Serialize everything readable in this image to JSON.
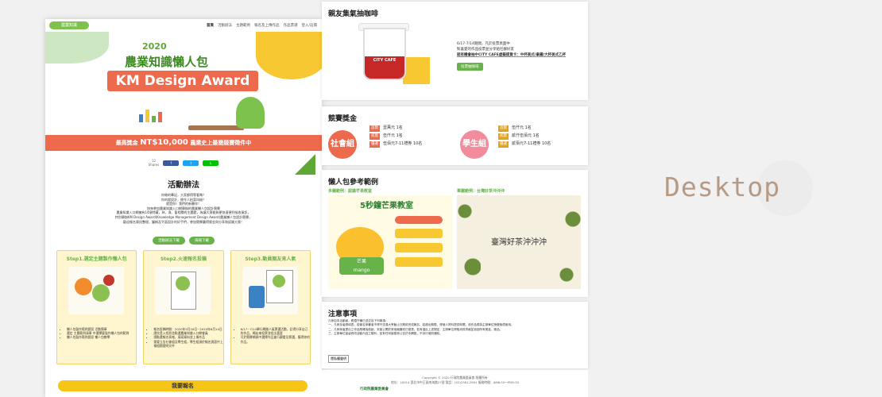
{
  "nav": {
    "logo": "農業知識",
    "items": [
      "首頁",
      "活動辦法",
      "主題範例",
      "報名及上傳作品",
      "作品票選",
      "登入/註冊"
    ]
  },
  "hero": {
    "year": "2020",
    "title": "農業知識懶人包",
    "award": "KM Design Award"
  },
  "prize": {
    "text": "最高獎金",
    "amount": "NT$10,000",
    "suffix": "農業史上最簡競賽徵件中"
  },
  "share": {
    "count": "12",
    "count_label": "Shares",
    "fb": "f",
    "tw": "t",
    "line": "L"
  },
  "activity": {
    "title": "活動辦法",
    "lines": [
      "你做的筆記，大家都得等看嗎？",
      "你的超設計，總令人拍案叫絕？",
      "就是你！我們的新夥伴！",
      "快來參加農業知識入口網舉辦的農業懶人包設計競賽",
      "農業知識入口網擁有14項特藏，林，漁、畜相關的主題館，為讓大眾能夠更快速便利吸收資訊，",
      "特別舉辦KM Design Award(Knowledge Management Design Award)農業懶人包設計競賽，",
      "歡迎報名資訊整理，圖納及平面設計的好手們，參加競賽贏得獎金與分享和認識大獎！"
    ],
    "btn1": "活動辦法下載",
    "btn2": "海報下載"
  },
  "steps": [
    {
      "title": "Step1.選定主題製作懶人包",
      "items": [
        "懶人包製作範例請見 活動簡章",
        "選定 主題範例清單 中選擇要製作懶人包的範例",
        "懶人包製作範例請見 懶人包教學"
      ]
    },
    {
      "title": "Step2.火速報名投稿",
      "items": [
        "報名投稿時間：2020年5月18日~2020年6月14日",
        "請先登入找到並點選農業知識入口網會員",
        "請點選報名表格，填寫資料並上傳作品",
        "需要立告社會組及學生組，學生組須於報名頁面中上傳相關證明文件"
      ]
    },
    {
      "title": "Step3.動員親友來人氣",
      "items": [
        "6/17~7/14舉行網路人氣票選活動，記得分享自己的作品，轉友來投票並投出喜愛",
        "可於競賽網頁中選擇作品進行觀看及票選，獲得你的作品。"
      ]
    }
  ],
  "signup": "我要報名",
  "coffee": {
    "title": "親友集氣抽咖啡",
    "lines": [
      "6/17-7/14期間，凡於投票頁面中",
      "對喜愛的作品投票並分享給社群好友",
      "就有機會抽中CITY CAFE虛擬提貨卡：中杯美式/拿鐵/大杯美式乙杯"
    ],
    "btn": "投票抽咖啡",
    "cup_label": "CITY CAFE"
  },
  "prizes": {
    "title": "競賽獎金",
    "social": "社會組",
    "student": "學生組",
    "social_list": [
      {
        "tag": "首獎",
        "text": "壹萬元 1名"
      },
      {
        "tag": "貳獎",
        "text": "伍仟元 1名"
      },
      {
        "tag": "優選",
        "text": "伍佰元7-11禮券 10名"
      }
    ],
    "student_list": [
      {
        "tag": "首獎",
        "text": "伍仟元 1名"
      },
      {
        "tag": "貳獎",
        "text": "貳仟伍佰元 1名"
      },
      {
        "tag": "優選",
        "text": "貳佰元7-11禮券 10名"
      }
    ]
  },
  "examples": {
    "title": "懶人包參考範例",
    "ex1": "多圖範例：認識芒果教室",
    "ex2": "單圖範例：台灣好茶沖沖沖",
    "ex1_title": "5秒鐘芒果教室",
    "ex1_word": "芒果",
    "ex1_en": "mango",
    "ex2_title": "臺灣好茶沖沖沖"
  },
  "notes": {
    "title": "注意事項",
    "intro": "凡參加本活動者，應遵守懶已送交及下列事項：",
    "items": [
      "一、凡參加者請填表，若報名參賽者不得不送達大會截止日期前完成報名、若超出期限、得個人資料提供時間，該作品視為主辦單位授權無償使用。",
      "二、凡參與者提出之作品應確為原創、未曾公開於其他競賽或已發表，若有違反上述規定，主辦單位得取消其資格並追回所有獎金、獎品。",
      "三、主辦單位保留修改活動內容之權利，如有任何變更將公告於本網頁，不另行個別通知。"
    ],
    "btn": "隱私權聲明"
  },
  "footer": {
    "copy": "Copyright © 2020 行政院農業委員會 版權所有",
    "addr": "地址：10014 臺北市中正區南海路27號 電話：(02)2381-2991 服務時間：AM8:30～PM5:30",
    "logo": "行政院農業委員會"
  },
  "label": "Desktop"
}
